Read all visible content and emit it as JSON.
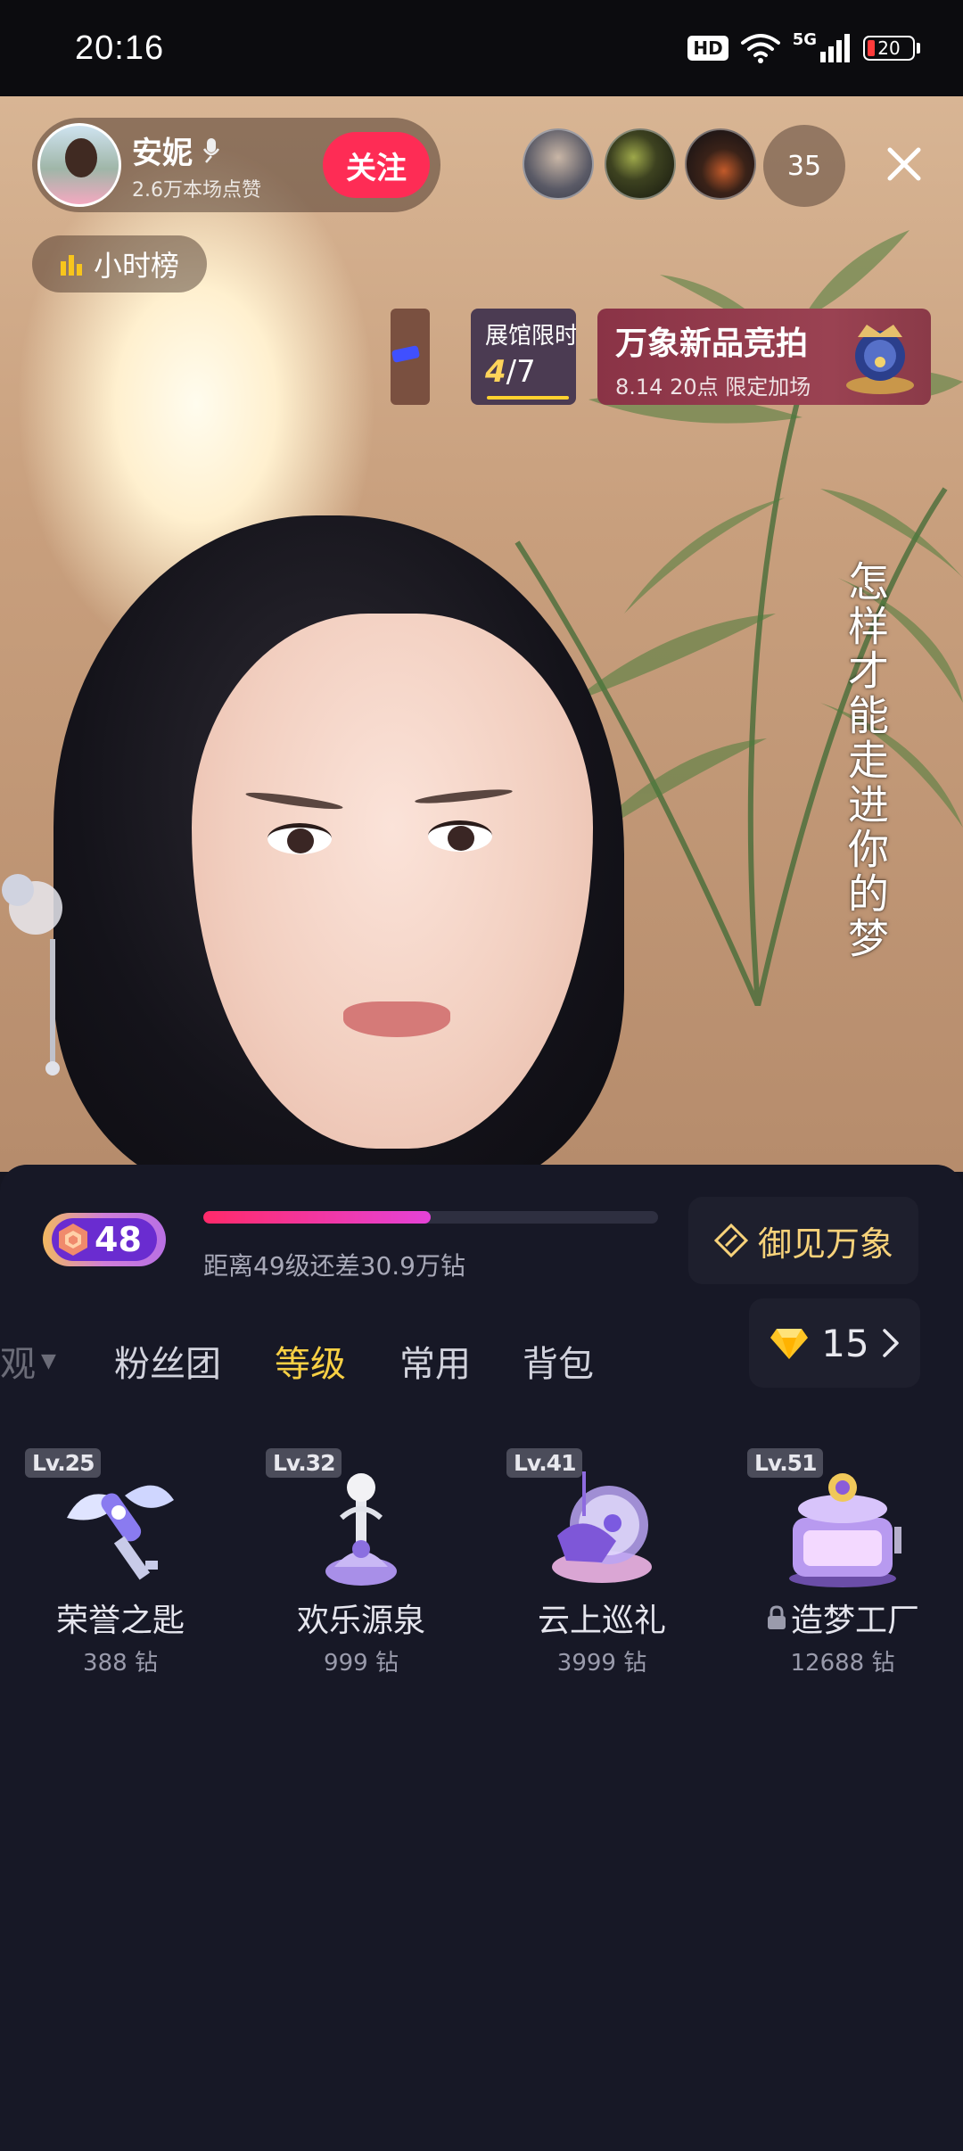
{
  "status_bar": {
    "time": "20:16",
    "hd_label": "HD",
    "network": "5G",
    "battery": "20"
  },
  "stream": {
    "host_name": "安妮",
    "host_likes": "2.6万本场点赞",
    "follow_label": "关注",
    "viewer_count": "35",
    "rank_label": "小时榜",
    "hall_banner": {
      "title": "展馆限时",
      "current": "4",
      "total": "/7"
    },
    "auction_banner": {
      "title": "万象新品竞拍",
      "subtitle": "8.14 20点 限定加场"
    },
    "lyrics": "怎样才能走进你的梦"
  },
  "gift_panel": {
    "level": "48",
    "progress_fraction": 0.5,
    "progress_text": "距离49级还差30.9万钻",
    "wanxiang_label": "御见万象",
    "tabs": [
      {
        "label": "观",
        "state": "partial"
      },
      {
        "label": "粉丝团",
        "state": "normal"
      },
      {
        "label": "等级",
        "state": "active"
      },
      {
        "label": "常用",
        "state": "normal"
      },
      {
        "label": "背包",
        "state": "normal"
      }
    ],
    "coins": "15",
    "gifts": [
      {
        "level": "Lv.25",
        "name": "荣誉之匙",
        "price": "388 钻",
        "locked": false
      },
      {
        "level": "Lv.32",
        "name": "欢乐源泉",
        "price": "999 钻",
        "locked": false
      },
      {
        "level": "Lv.41",
        "name": "云上巡礼",
        "price": "3999 钻",
        "locked": false
      },
      {
        "level": "Lv.51",
        "name": "造梦工厂",
        "price": "12688 钻",
        "locked": true
      }
    ]
  },
  "colors": {
    "follow_button": "#fe2c55",
    "active_tab": "#f8d044",
    "progress_start": "#ff2a6a",
    "progress_end": "#e543d8",
    "panel_bg": "#171826"
  },
  "icons": [
    "wifi-icon",
    "signal-icon",
    "battery-icon",
    "mic-icon",
    "close-icon",
    "bars-icon",
    "diamond-icon",
    "chevron-right-icon",
    "lock-icon",
    "wanxiang-icon"
  ]
}
